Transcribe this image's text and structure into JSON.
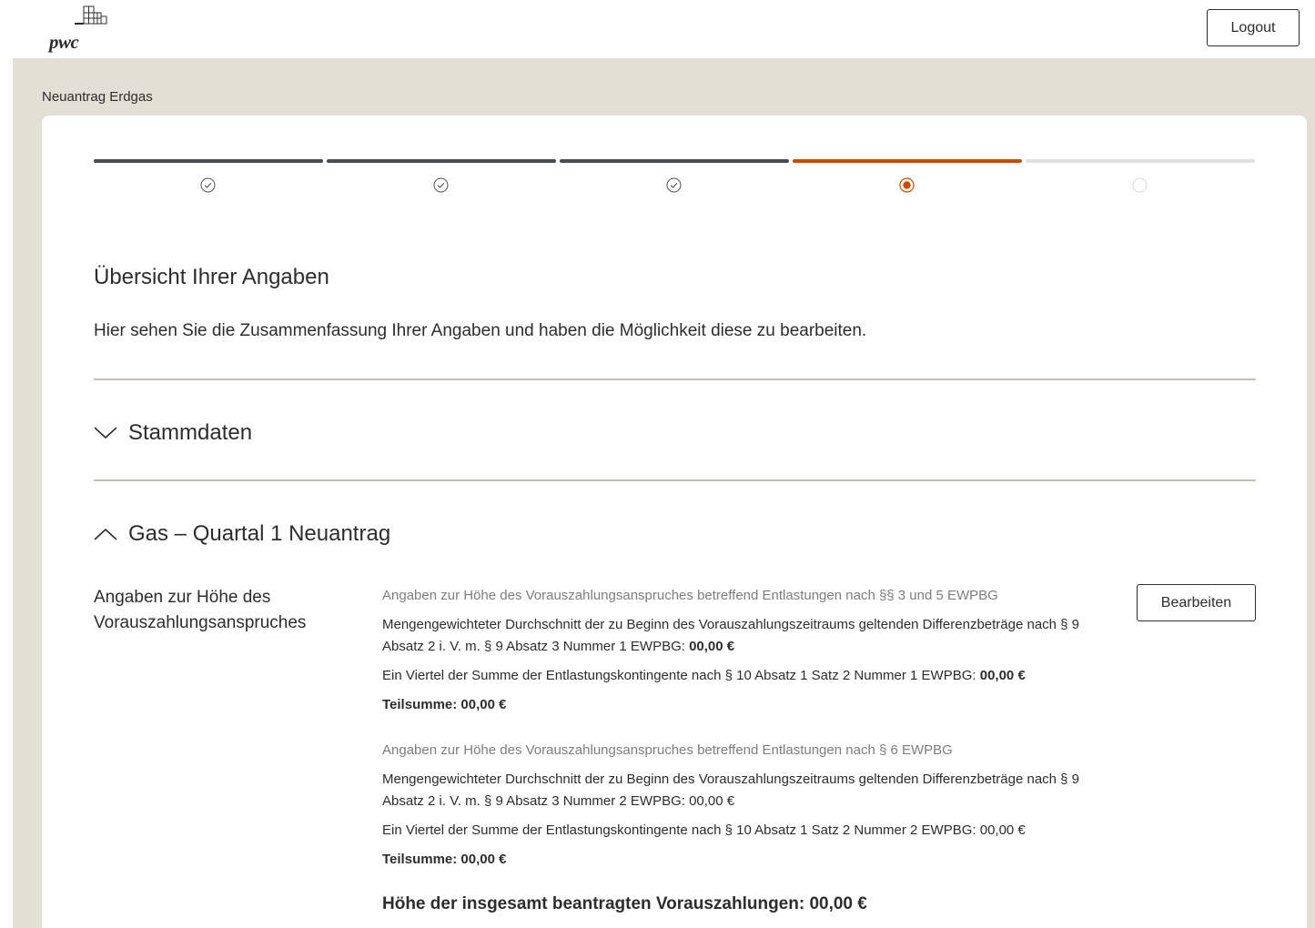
{
  "header": {
    "logo_text": "pwc",
    "logout_label": "Logout"
  },
  "page": {
    "title": "Neuantrag Erdgas"
  },
  "stepper": {
    "steps": [
      {
        "state": "done",
        "icon": "check-circle-icon"
      },
      {
        "state": "done",
        "icon": "check-circle-icon"
      },
      {
        "state": "done",
        "icon": "check-circle-icon"
      },
      {
        "state": "active",
        "icon": "radio-active-icon"
      },
      {
        "state": "todo",
        "icon": "circle-empty-icon"
      }
    ],
    "colors": {
      "done": "#464d55",
      "active": "#d04a02",
      "todo": "#e1e1e1"
    }
  },
  "overview": {
    "heading": "Übersicht Ihrer Angaben",
    "intro": "Hier sehen Sie die Zusammenfassung Ihrer Angaben und haben die Möglichkeit diese zu bearbeiten."
  },
  "accordions": [
    {
      "title": "Stammdaten",
      "expanded": false,
      "icon": "chevron-down-icon"
    },
    {
      "title": "Gas – Quartal 1 Neuantrag",
      "expanded": true,
      "icon": "chevron-up-icon"
    }
  ],
  "section": {
    "label": "Angaben zur Höhe des Vorauszahlungsanspruches",
    "edit_label": "Bearbeiten",
    "group1": {
      "heading": "Angaben zur Höhe des Vorauszahlungsanspruches betreffend Entlastungen nach §§ 3 und 5 EWPBG",
      "line1_text": "Mengengewichteter Durchschnitt der zu Beginn des Vorauszahlungszeitraums geltenden Differenzbeträge nach § 9 Absatz 2 i. V. m. § 9 Absatz 3 Nummer 1 EWPBG: ",
      "line1_value": "00,00 €",
      "line2_text": "Ein Viertel der Summe der Entlastungskontingente nach § 10 Absatz 1 Satz 2 Nummer 1 EWPBG: ",
      "line2_value": "00,00 €",
      "subtotal": "Teilsumme: 00,00 €"
    },
    "group2": {
      "heading": "Angaben zur Höhe des Vorauszahlungsanspruches betreffend Entlastungen nach § 6 EWPBG",
      "line1": "Mengengewichteter Durchschnitt der zu Beginn des Vorauszahlungszeitraums geltenden Differenzbeträge nach § 9 Absatz 2 i. V. m. § 9 Absatz 3 Nummer 2 EWPBG: 00,00 €",
      "line2": "Ein Viertel der Summe der Entlastungskontingente nach § 10 Absatz 1 Satz 2 Nummer 2 EWPBG: 00,00 €",
      "subtotal": "Teilsumme: 00,00 €"
    },
    "total": "Höhe der insgesamt beantragten Vorauszahlungen: 00,00 €"
  }
}
